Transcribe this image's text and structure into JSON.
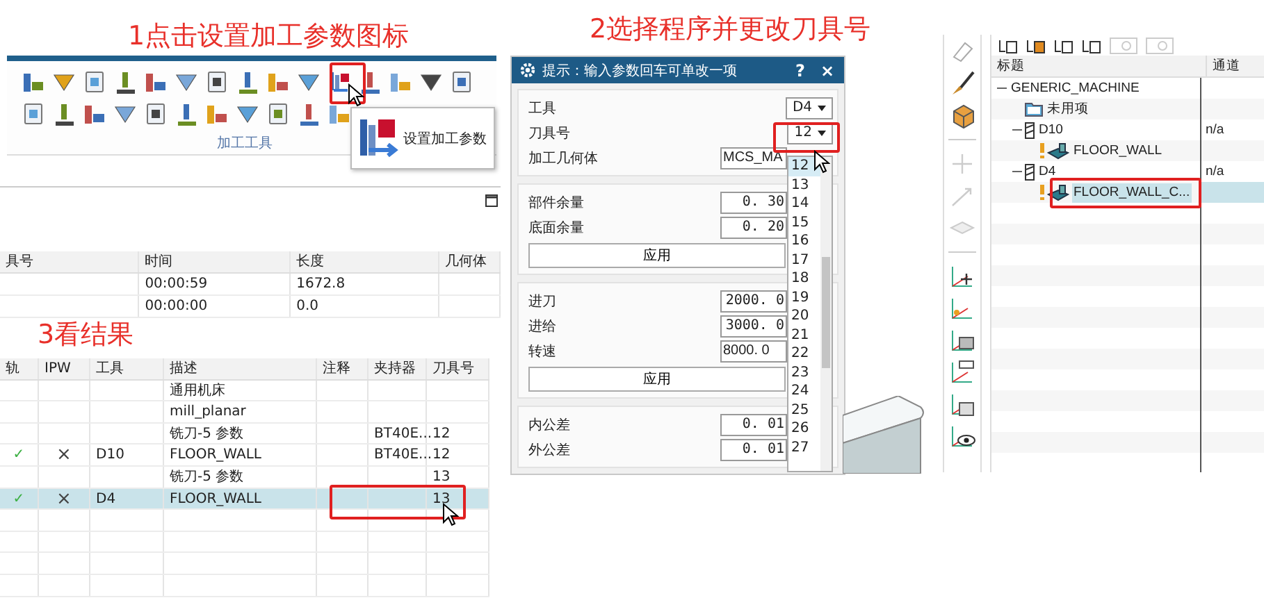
{
  "steps": [
    {
      "text": "1点击设置加工参数图标"
    },
    {
      "text": "2选择程序并更改刀具号"
    },
    {
      "text": "3看结果"
    }
  ],
  "ribbon": {
    "group_label": "加工工具",
    "tooltip": {
      "text": "设置加工参数"
    }
  },
  "summary_table": {
    "columns": [
      "具号",
      "时间",
      "长度",
      "几何体"
    ],
    "rows": [
      [
        "",
        "00:00:59",
        "1672.8",
        ""
      ],
      [
        "",
        "00:00:00",
        "0.0",
        ""
      ]
    ]
  },
  "operation_table": {
    "columns": [
      "轨",
      "IPW",
      "工具",
      "描述",
      "注释",
      "夹持器",
      "刀具号"
    ],
    "rows": [
      {
        "cells": [
          "",
          "",
          "",
          "通用机床",
          "",
          "",
          ""
        ],
        "selected": false
      },
      {
        "cells": [
          "",
          "",
          "",
          "mill_planar",
          "",
          "",
          ""
        ],
        "selected": false
      },
      {
        "cells": [
          "",
          "",
          "",
          "铣刀-5 参数",
          "",
          "BT40E...",
          "12"
        ],
        "selected": false
      },
      {
        "cells": [
          "✓",
          "×",
          "D10",
          "FLOOR_WALL",
          "",
          "BT40E...",
          "12"
        ],
        "selected": false
      },
      {
        "cells": [
          "",
          "",
          "",
          "铣刀-5 参数",
          "",
          "",
          "13"
        ],
        "selected": false
      },
      {
        "cells": [
          "✓",
          "×",
          "D4",
          "FLOOR_WALL",
          "",
          "",
          "13"
        ],
        "selected": true
      }
    ]
  },
  "dialog": {
    "title": "提示：输入参数回车可单改一项",
    "help": "?",
    "close": "×",
    "sections": [
      {
        "fields": [
          {
            "kind": "dropdown",
            "label": "工具",
            "value": "D4"
          },
          {
            "kind": "dropdown",
            "label": "刀具号",
            "value": "12"
          },
          {
            "kind": "input",
            "label": "加工几何体",
            "value": "MCS_MA"
          }
        ]
      },
      {
        "fields": [
          {
            "kind": "input",
            "label": "部件余量",
            "value": "0. 30"
          },
          {
            "kind": "input",
            "label": "底面余量",
            "value": "0. 20"
          }
        ],
        "button": "应用"
      },
      {
        "fields": [
          {
            "kind": "input",
            "label": "进刀",
            "value": "2000. 0"
          },
          {
            "kind": "input",
            "label": "进给",
            "value": "3000. 0"
          },
          {
            "kind": "input",
            "label": "转速",
            "value": "8000. 0"
          }
        ],
        "button": "应用"
      },
      {
        "fields": [
          {
            "kind": "input",
            "label": "内公差",
            "value": "0. 01"
          },
          {
            "kind": "input",
            "label": "外公差",
            "value": "0. 01"
          }
        ]
      }
    ],
    "dropdown_list": [
      {
        "label": "12",
        "selected": true
      },
      {
        "label": "13",
        "selected": false
      },
      {
        "label": "14",
        "selected": false
      },
      {
        "label": "15",
        "selected": false
      },
      {
        "label": "16",
        "selected": false
      },
      {
        "label": "17",
        "selected": false
      },
      {
        "label": "18",
        "selected": false
      },
      {
        "label": "19",
        "selected": false
      },
      {
        "label": "20",
        "selected": false
      },
      {
        "label": "21",
        "selected": false
      },
      {
        "label": "22",
        "selected": false
      },
      {
        "label": "23",
        "selected": false
      },
      {
        "label": "24",
        "selected": false
      },
      {
        "label": "25",
        "selected": false
      },
      {
        "label": "26",
        "selected": false
      },
      {
        "label": "27",
        "selected": false
      }
    ]
  },
  "tree": {
    "columns": [
      "标题",
      "通道"
    ],
    "nodes": [
      {
        "label": "GENERIC_MACHINE",
        "expanded": true,
        "selected": false,
        "children": [
          {
            "kind": "folder",
            "label": "未用项",
            "selected": false
          },
          {
            "kind": "tool",
            "label": "D10",
            "channel": "n/a",
            "expanded": true,
            "selected": false,
            "children": [
              {
                "kind": "operation",
                "label": "FLOOR_WALL",
                "selected": false
              }
            ]
          },
          {
            "kind": "tool",
            "label": "D4",
            "channel": "n/a",
            "expanded": true,
            "selected": false,
            "children": [
              {
                "kind": "operation",
                "label": "FLOOR_WALL_C...",
                "selected": true
              }
            ]
          }
        ]
      }
    ]
  }
}
